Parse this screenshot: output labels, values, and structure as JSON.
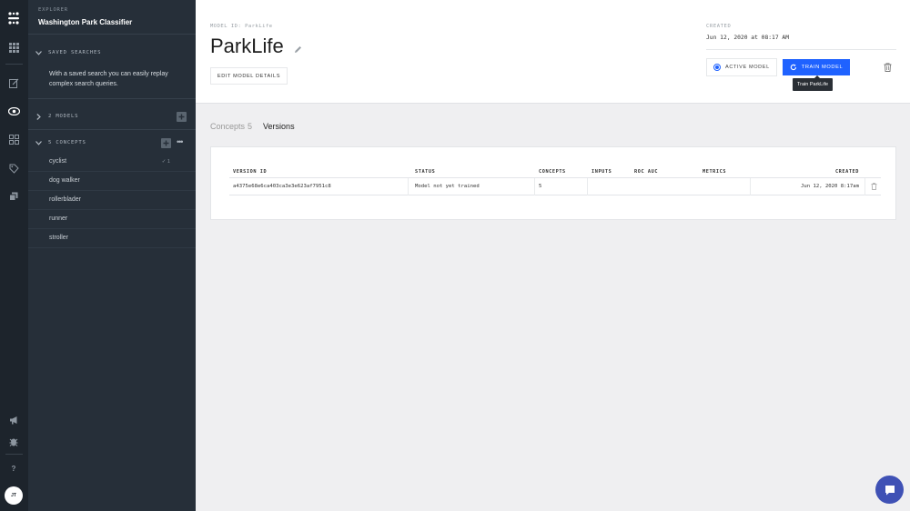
{
  "rail": {
    "avatar_initials": "JT",
    "help_label": "?"
  },
  "sidebar": {
    "eyebrow": "EXPLORER",
    "app_name": "Washington Park Classifier",
    "saved_searches": {
      "title": "SAVED SEARCHES",
      "description": "With a saved search you can easily replay complex search queries."
    },
    "models": {
      "title": "2 MODELS"
    },
    "concepts": {
      "title": "5 CONCEPTS",
      "more_label": "•••",
      "items": [
        {
          "label": "cyclist",
          "count": "✓ 1"
        },
        {
          "label": "dog walker",
          "count": ""
        },
        {
          "label": "rollerblader",
          "count": ""
        },
        {
          "label": "runner",
          "count": ""
        },
        {
          "label": "stroller",
          "count": ""
        }
      ]
    }
  },
  "header": {
    "model_id": "MODEL ID: ParkLife",
    "model_name": "ParkLife",
    "edit_label": "EDIT MODEL DETAILS",
    "created_label": "CREATED",
    "created_value": "Jun 12, 2020 at 08:17 AM",
    "active_label": "ACTIVE MODEL",
    "train_label": "TRAIN MODEL",
    "tooltip": "Train ParkLife"
  },
  "tabs": [
    {
      "label": "Concepts",
      "count": "5",
      "active": false
    },
    {
      "label": "Versions",
      "count": "",
      "active": true
    }
  ],
  "versions_table": {
    "columns": [
      "VERSION ID",
      "STATUS",
      "CONCEPTS",
      "INPUTS",
      "ROC AUC",
      "METRICS",
      "CREATED"
    ],
    "rows": [
      {
        "version_id": "a4375e68e6ca403ca3e3e623af7951c8",
        "status": "Model not yet trained",
        "concepts": "5",
        "inputs": "",
        "roc_auc": "",
        "metrics": "",
        "created": "Jun 12, 2020 8:17am"
      }
    ]
  },
  "colors": {
    "rail_bg": "#1d242c",
    "sidebar_bg": "#262f39",
    "accent": "#1f62ff",
    "chat_bubble": "#3f51b5"
  }
}
